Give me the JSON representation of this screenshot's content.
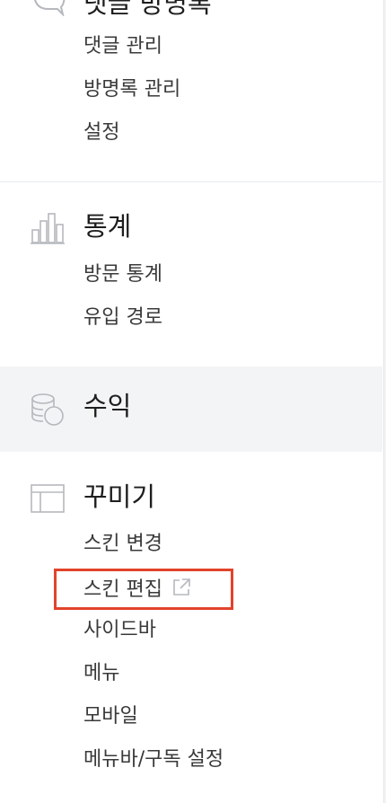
{
  "sections": {
    "comments": {
      "title": "댓글 방명록",
      "items": [
        "댓글 관리",
        "방명록 관리",
        "설정"
      ]
    },
    "stats": {
      "title": "통계",
      "items": [
        "방문 통계",
        "유입 경로"
      ]
    },
    "revenue": {
      "title": "수익"
    },
    "decorate": {
      "title": "꾸미기",
      "items": [
        "스킨 변경",
        "스킨 편집",
        "사이드바",
        "메뉴",
        "모바일",
        "메뉴바/구독 설정"
      ]
    }
  },
  "colors": {
    "highlight": "#e2432a",
    "active_bg": "#f3f4f6",
    "icon_stroke": "#b5b8bd"
  },
  "icons": {
    "comments": "speech-bubble-icon",
    "stats": "bar-chart-icon",
    "revenue": "coins-icon",
    "decorate": "layout-icon",
    "skin_edit": "external-link-icon"
  }
}
